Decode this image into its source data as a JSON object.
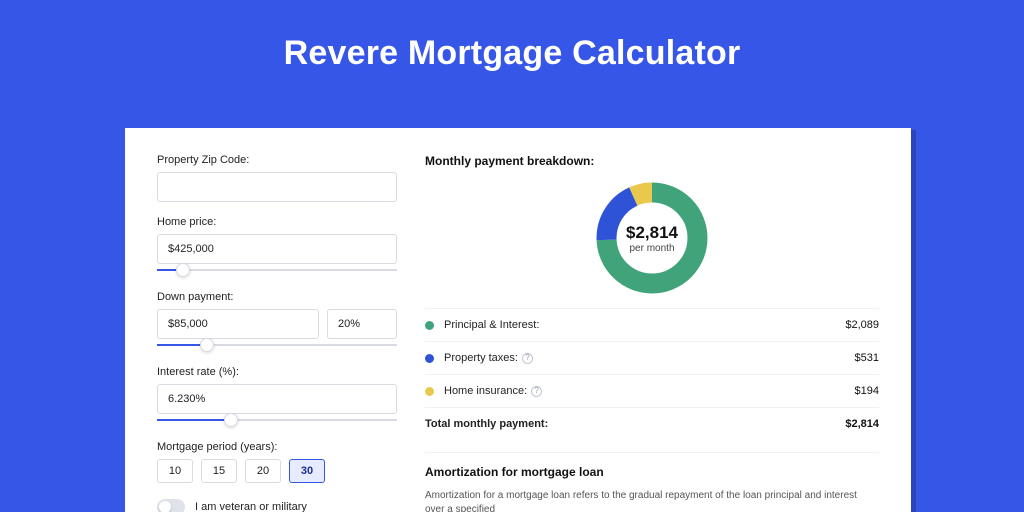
{
  "title": "Revere Mortgage Calculator",
  "left": {
    "zip_label": "Property Zip Code:",
    "zip_value": "",
    "home_price_label": "Home price:",
    "home_price_value": "$425,000",
    "down_payment_label": "Down payment:",
    "down_payment_value": "$85,000",
    "down_payment_pct": "20%",
    "interest_label": "Interest rate (%):",
    "interest_value": "6.230%",
    "period_label": "Mortgage period (years):",
    "periods": [
      "10",
      "15",
      "20",
      "30"
    ],
    "period_active": "30",
    "veteran_label": "I am veteran or military"
  },
  "chart_data": {
    "type": "pie",
    "title": "Monthly payment breakdown:",
    "center_value": "$2,814",
    "center_sub": "per month",
    "series": [
      {
        "name": "Principal & Interest:",
        "value": 2089,
        "display": "$2,089",
        "color": "#41a37a"
      },
      {
        "name": "Property taxes:",
        "value": 531,
        "display": "$531",
        "color": "#2f53d6"
      },
      {
        "name": "Home insurance:",
        "value": 194,
        "display": "$194",
        "color": "#e9c94d"
      }
    ],
    "total_label": "Total monthly payment:",
    "total_display": "$2,814"
  },
  "amort": {
    "title": "Amortization for mortgage loan",
    "text": "Amortization for a mortgage loan refers to the gradual repayment of the loan principal and interest over a specified"
  }
}
